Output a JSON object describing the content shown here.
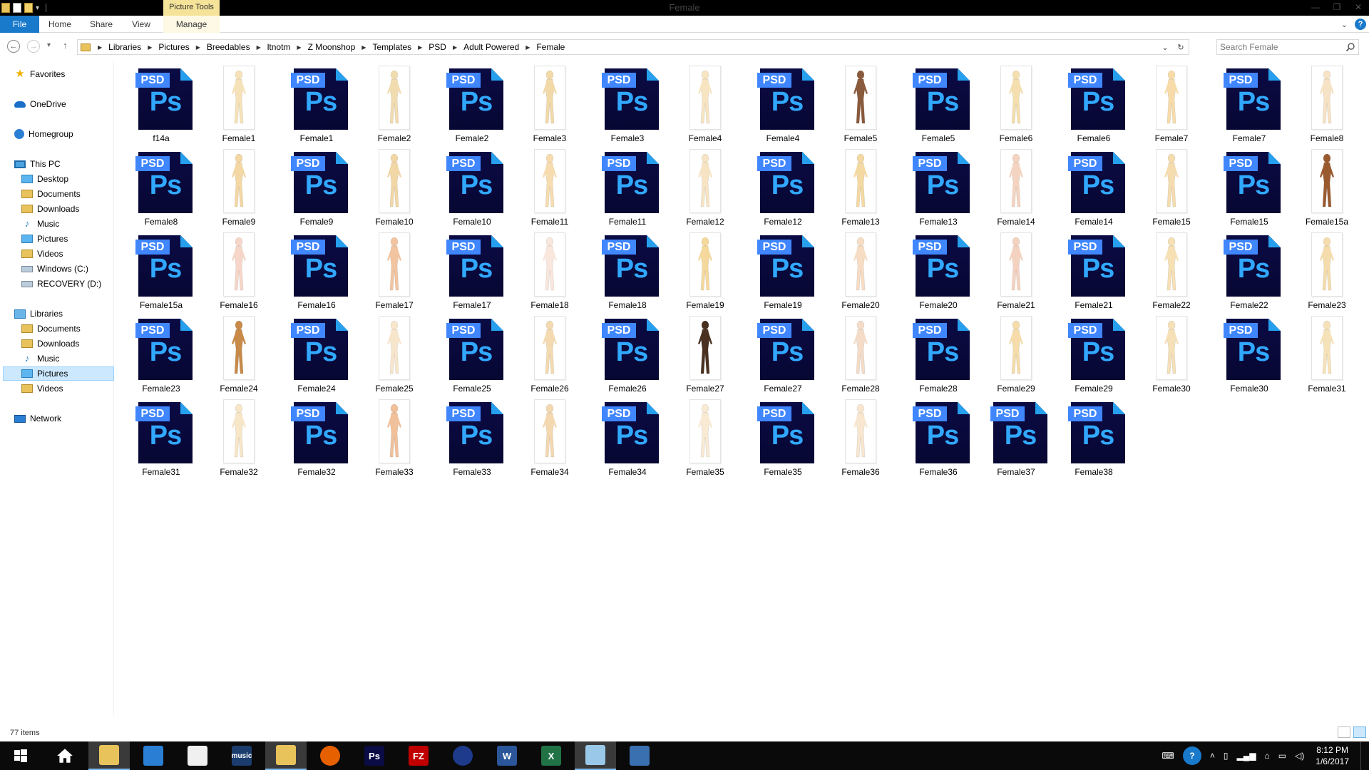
{
  "window": {
    "title": "Female",
    "contextual_tab_group": "Picture Tools"
  },
  "ribbon": {
    "tabs": [
      "File",
      "Home",
      "Share",
      "View",
      "Manage"
    ]
  },
  "address": {
    "breadcrumbs": [
      "Libraries",
      "Pictures",
      "Breedables",
      "ltnotm",
      "Z Moonshop",
      "Templates",
      "PSD",
      "Adult Powered",
      "Female"
    ]
  },
  "search": {
    "placeholder": "Search Female"
  },
  "navpane": {
    "favorites": "Favorites",
    "onedrive": "OneDrive",
    "homegroup": "Homegroup",
    "thispc": "This PC",
    "pc_items": [
      "Desktop",
      "Documents",
      "Downloads",
      "Music",
      "Pictures",
      "Videos",
      "Windows (C:)",
      "RECOVERY (D:)"
    ],
    "libraries": "Libraries",
    "lib_items": [
      "Documents",
      "Downloads",
      "Music",
      "Pictures",
      "Videos"
    ],
    "selected": "Pictures",
    "network": "Network"
  },
  "files": [
    {
      "name": "f14a",
      "type": "psd"
    },
    {
      "name": "Female1",
      "type": "png",
      "skin": "#f6e2b8"
    },
    {
      "name": "Female1",
      "type": "psd"
    },
    {
      "name": "Female2",
      "type": "png",
      "skin": "#f1dcb0"
    },
    {
      "name": "Female2",
      "type": "psd"
    },
    {
      "name": "Female3",
      "type": "png",
      "skin": "#f2d9a8"
    },
    {
      "name": "Female3",
      "type": "psd"
    },
    {
      "name": "Female4",
      "type": "png",
      "skin": "#f7e5c2"
    },
    {
      "name": "Female4",
      "type": "psd"
    },
    {
      "name": "Female5",
      "type": "png",
      "skin": "#8a5a3c"
    },
    {
      "name": "Female5",
      "type": "psd"
    },
    {
      "name": "Female6",
      "type": "png",
      "skin": "#f5dfae"
    },
    {
      "name": "Female6",
      "type": "psd"
    },
    {
      "name": "Female7",
      "type": "png",
      "skin": "#f7dcaa"
    },
    {
      "name": "Female7",
      "type": "psd"
    },
    {
      "name": "Female8",
      "type": "png",
      "skin": "#f6e2c4"
    },
    {
      "name": "Female8",
      "type": "psd"
    },
    {
      "name": "Female9",
      "type": "png",
      "skin": "#f3d7a4"
    },
    {
      "name": "Female9",
      "type": "psd"
    },
    {
      "name": "Female10",
      "type": "png",
      "skin": "#f1d6a6"
    },
    {
      "name": "Female10",
      "type": "psd"
    },
    {
      "name": "Female11",
      "type": "png",
      "skin": "#f6dcaf"
    },
    {
      "name": "Female11",
      "type": "psd"
    },
    {
      "name": "Female12",
      "type": "png",
      "skin": "#f7e4c4"
    },
    {
      "name": "Female12",
      "type": "psd"
    },
    {
      "name": "Female13",
      "type": "png",
      "skin": "#f4d9a2"
    },
    {
      "name": "Female13",
      "type": "psd"
    },
    {
      "name": "Female14",
      "type": "png",
      "skin": "#f4d4c0"
    },
    {
      "name": "Female14",
      "type": "psd"
    },
    {
      "name": "Female15",
      "type": "png",
      "skin": "#f5dcae"
    },
    {
      "name": "Female15",
      "type": "psd"
    },
    {
      "name": "Female15a",
      "type": "png",
      "skin": "#9a5a30"
    },
    {
      "name": "Female15a",
      "type": "psd"
    },
    {
      "name": "Female16",
      "type": "png",
      "skin": "#f6d6c8"
    },
    {
      "name": "Female16",
      "type": "psd"
    },
    {
      "name": "Female17",
      "type": "png",
      "skin": "#f2c4a0"
    },
    {
      "name": "Female17",
      "type": "psd"
    },
    {
      "name": "Female18",
      "type": "png",
      "skin": "#f9e6dc"
    },
    {
      "name": "Female18",
      "type": "psd"
    },
    {
      "name": "Female19",
      "type": "png",
      "skin": "#f5d89c"
    },
    {
      "name": "Female19",
      "type": "psd"
    },
    {
      "name": "Female20",
      "type": "png",
      "skin": "#f7ddc4"
    },
    {
      "name": "Female20",
      "type": "psd"
    },
    {
      "name": "Female21",
      "type": "png",
      "skin": "#f4d2c0"
    },
    {
      "name": "Female21",
      "type": "psd"
    },
    {
      "name": "Female22",
      "type": "png",
      "skin": "#f6e0b4"
    },
    {
      "name": "Female22",
      "type": "psd"
    },
    {
      "name": "Female23",
      "type": "png",
      "skin": "#f4dcac"
    },
    {
      "name": "Female23",
      "type": "psd"
    },
    {
      "name": "Female24",
      "type": "png",
      "skin": "#c88a48"
    },
    {
      "name": "Female24",
      "type": "psd"
    },
    {
      "name": "Female25",
      "type": "png",
      "skin": "#f8e6cc"
    },
    {
      "name": "Female25",
      "type": "psd"
    },
    {
      "name": "Female26",
      "type": "png",
      "skin": "#f4dab0"
    },
    {
      "name": "Female26",
      "type": "psd"
    },
    {
      "name": "Female27",
      "type": "png",
      "skin": "#4a3020"
    },
    {
      "name": "Female27",
      "type": "psd"
    },
    {
      "name": "Female28",
      "type": "png",
      "skin": "#f4dcc8"
    },
    {
      "name": "Female28",
      "type": "psd"
    },
    {
      "name": "Female29",
      "type": "png",
      "skin": "#f5dcaa"
    },
    {
      "name": "Female29",
      "type": "psd"
    },
    {
      "name": "Female30",
      "type": "png",
      "skin": "#f6e0b8"
    },
    {
      "name": "Female30",
      "type": "psd"
    },
    {
      "name": "Female31",
      "type": "png",
      "skin": "#f6e2b8"
    },
    {
      "name": "Female31",
      "type": "psd"
    },
    {
      "name": "Female32",
      "type": "png",
      "skin": "#f7e6c8"
    },
    {
      "name": "Female32",
      "type": "psd"
    },
    {
      "name": "Female33",
      "type": "png",
      "skin": "#f0c09a"
    },
    {
      "name": "Female33",
      "type": "psd"
    },
    {
      "name": "Female34",
      "type": "png",
      "skin": "#f4d8b0"
    },
    {
      "name": "Female34",
      "type": "psd"
    },
    {
      "name": "Female35",
      "type": "png",
      "skin": "#f9ead4"
    },
    {
      "name": "Female35",
      "type": "psd"
    },
    {
      "name": "Female36",
      "type": "png",
      "skin": "#f8e6d0"
    },
    {
      "name": "Female36",
      "type": "psd"
    },
    {
      "name": "Female37",
      "type": "psd"
    },
    {
      "name": "Female38",
      "type": "psd"
    }
  ],
  "icons": {
    "psd_tag": "PSD",
    "psd_glyph": "Ps"
  },
  "status": {
    "item_count": "77 items"
  },
  "taskbar": {
    "apps": [
      {
        "name": "start-button",
        "color": "#0a0a0a"
      },
      {
        "name": "home-app",
        "color": "#0a0a0a"
      },
      {
        "name": "file-explorer",
        "color": "#e8c25a"
      },
      {
        "name": "mail-app",
        "color": "#2a7fd4"
      },
      {
        "name": "notepad-app",
        "color": "#f0f0f0"
      },
      {
        "name": "amazon-music-app",
        "color": "#1b3d6e",
        "label": "music"
      },
      {
        "name": "network-tool-app",
        "color": "#e8c25a"
      },
      {
        "name": "firefox-app",
        "color": "#e66000"
      },
      {
        "name": "photoshop-app",
        "color": "#0b0b45",
        "label": "Ps"
      },
      {
        "name": "filezilla-app",
        "color": "#c00000",
        "label": "FZ"
      },
      {
        "name": "eclipse-app",
        "color": "#1e3a8a"
      },
      {
        "name": "word-app",
        "color": "#2b579a",
        "label": "W"
      },
      {
        "name": "excel-app",
        "color": "#217346",
        "label": "X"
      },
      {
        "name": "paint-app",
        "color": "#9ac8e8"
      },
      {
        "name": "calculator-app",
        "color": "#3a6fb0"
      }
    ],
    "clock_time": "8:12 PM",
    "clock_date": "1/6/2017"
  }
}
